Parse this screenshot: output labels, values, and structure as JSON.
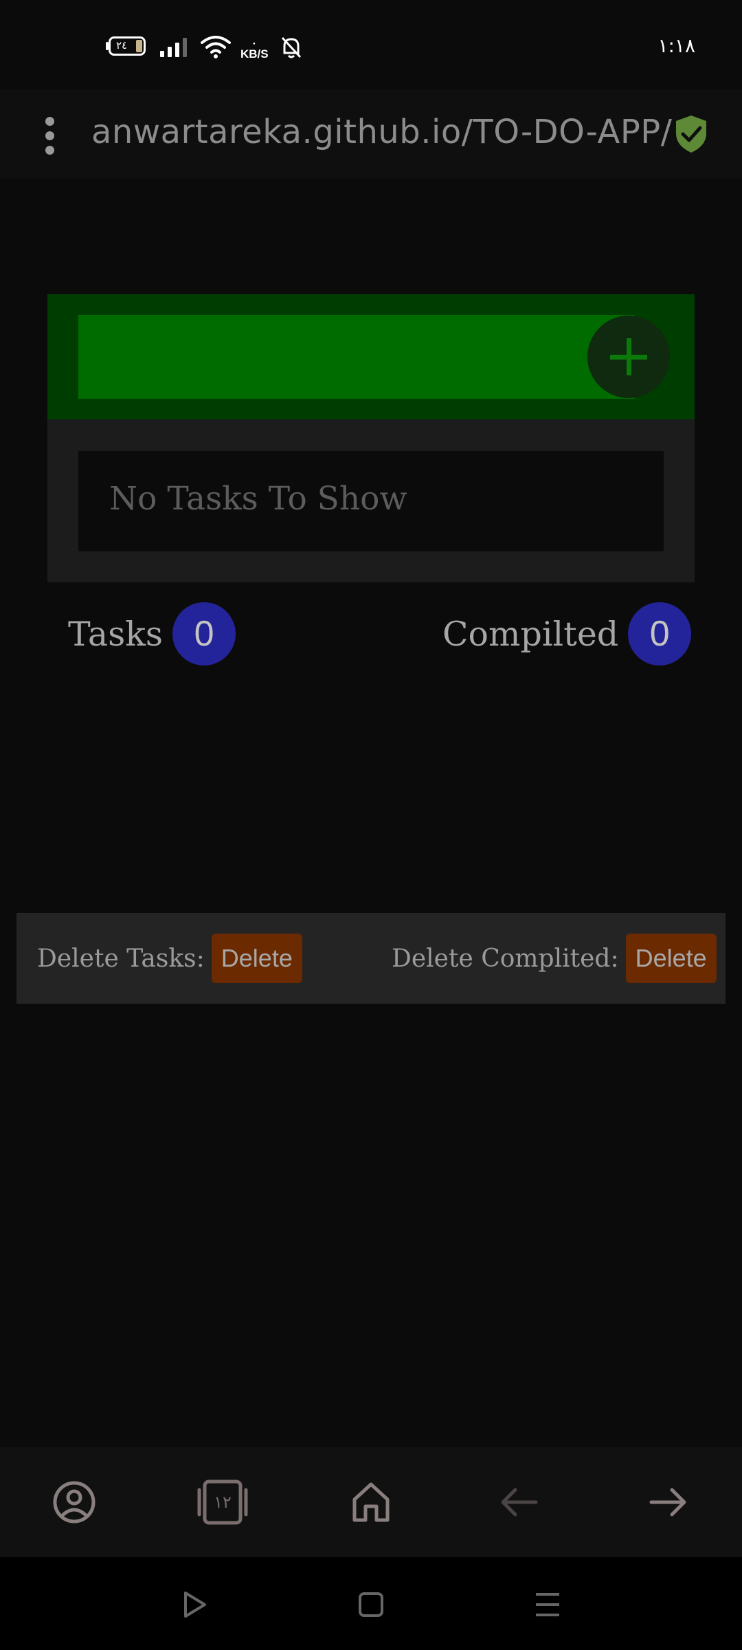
{
  "status_bar": {
    "battery_level": "٢٤",
    "net_speed_unit": "KB/S",
    "time": "١:١٨"
  },
  "browser": {
    "url": "anwartareka.github.io/TO-DO-APP/",
    "tab_count": "١٢"
  },
  "todo": {
    "input_value": "",
    "empty_message": "No Tasks To Show",
    "tasks_label": "Tasks",
    "tasks_count": "0",
    "completed_label": "Compilted",
    "completed_count": "0"
  },
  "delete_bar": {
    "delete_tasks_label": "Delete Tasks:",
    "delete_tasks_button": "Delete",
    "delete_completed_label": "Delete Complited:",
    "delete_completed_button": "Delete"
  },
  "colors": {
    "background": "#0b0b0b",
    "input_band": "#003d00",
    "input_field": "#006c00",
    "counter_badge": "#24249a",
    "delete_button": "#6b2a00",
    "shield": "#5e8a38"
  }
}
